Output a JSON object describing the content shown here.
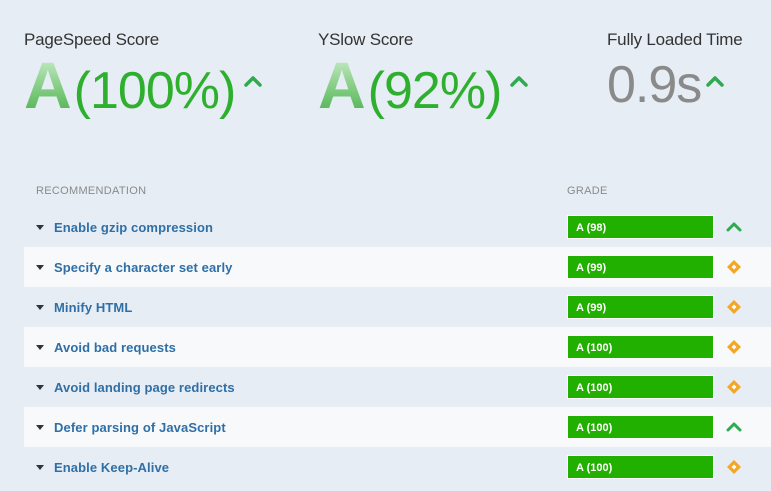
{
  "scores": {
    "pagespeed": {
      "label": "PageSpeed Score",
      "grade": "A",
      "percent": "(100%)"
    },
    "yslow": {
      "label": "YSlow Score",
      "grade": "A",
      "percent": "(92%)"
    },
    "loaded": {
      "label": "Fully Loaded Time",
      "value": "0.9s"
    }
  },
  "table": {
    "headers": {
      "recommendation": "RECOMMENDATION",
      "grade": "GRADE"
    },
    "rows": [
      {
        "label": "Enable gzip compression",
        "grade": "A (98)",
        "icon": "chevron-up-icon",
        "icon_color": "#2eab4f"
      },
      {
        "label": "Specify a character set early",
        "grade": "A (99)",
        "icon": "diamond-icon",
        "icon_color": "#f5a623"
      },
      {
        "label": "Minify HTML",
        "grade": "A (99)",
        "icon": "diamond-icon",
        "icon_color": "#f5a623"
      },
      {
        "label": "Avoid bad requests",
        "grade": "A (100)",
        "icon": "diamond-icon",
        "icon_color": "#f5a623"
      },
      {
        "label": "Avoid landing page redirects",
        "grade": "A (100)",
        "icon": "diamond-icon",
        "icon_color": "#f5a623"
      },
      {
        "label": "Defer parsing of JavaScript",
        "grade": "A (100)",
        "icon": "chevron-up-icon",
        "icon_color": "#2eab4f"
      },
      {
        "label": "Enable Keep-Alive",
        "grade": "A (100)",
        "icon": "diamond-icon",
        "icon_color": "#f5a623"
      }
    ]
  },
  "colors": {
    "grade_green": "#22b000",
    "link_blue": "#2f6fa6",
    "warn_orange": "#f5a623"
  }
}
